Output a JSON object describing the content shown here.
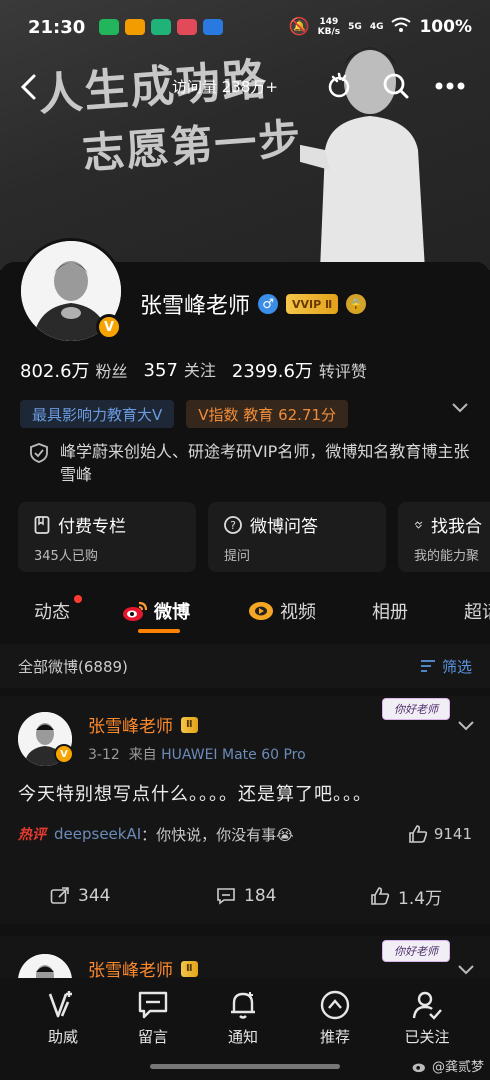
{
  "statusbar": {
    "time": "21:30",
    "net_speed": "149",
    "net_unit": "KB/s",
    "sig1": "5G",
    "sig2": "4G",
    "battery": "100%",
    "app_colors": [
      "#22b55c",
      "#f29c00",
      "#1fb37a",
      "#e24a5a",
      "#2a79e0"
    ]
  },
  "header": {
    "visits": "访问量 238万+",
    "banner_line1": "人生成功路",
    "banner_line2": "志愿第一步"
  },
  "profile": {
    "name": "张雪峰老师",
    "gender_icon": "♂",
    "vvip": "VVIP Ⅱ",
    "v_badge": "V",
    "stats": [
      {
        "value": "802.6万",
        "label": "粉丝"
      },
      {
        "value": "357",
        "label": "关注"
      },
      {
        "value": "2399.6万",
        "label": "转评赞"
      }
    ],
    "tags": [
      "最具影响力教育大V",
      "V指数 教育 62.71分"
    ],
    "bio": "峰学蔚来创始人、研途考研VIP名师，微博知名教育博主张雪峰"
  },
  "cards": [
    {
      "title": "付费专栏",
      "sub": "345人已购",
      "icon": "bookmark-icon"
    },
    {
      "title": "微博问答",
      "sub": "提问",
      "icon": "question-icon"
    },
    {
      "title": "找我合",
      "sub": "我的能力聚",
      "icon": "handshake-icon"
    }
  ],
  "tabs": [
    "动态",
    "微博",
    "视频",
    "相册",
    "超话"
  ],
  "filter": {
    "label": "全部微博(6889)",
    "button": "筛选"
  },
  "posts": [
    {
      "name": "张雪峰老师",
      "vip": "Ⅱ",
      "date": "3-12",
      "from": "来自",
      "device": "HUAWEI Mate 60 Pro",
      "sticker": "你好老师",
      "text": "今天特别想写点什么。。。。还是算了吧。。。",
      "hot_label": "热评",
      "hot_user": "deepseekAI",
      "hot_text": "：你快说，你没有事😭",
      "hot_likes": "9141",
      "reposts": "344",
      "comments": "184",
      "likes": "1.4万"
    },
    {
      "name": "张雪峰老师",
      "vip": "Ⅱ",
      "sticker": "你好老师"
    }
  ],
  "bottombar": [
    {
      "label": "助威",
      "icon": "cheer-icon"
    },
    {
      "label": "留言",
      "icon": "message-icon"
    },
    {
      "label": "通知",
      "icon": "bell-icon"
    },
    {
      "label": "推荐",
      "icon": "recommend-icon"
    },
    {
      "label": "已关注",
      "icon": "followed-icon"
    }
  ],
  "watermark": "@龚贰梦"
}
